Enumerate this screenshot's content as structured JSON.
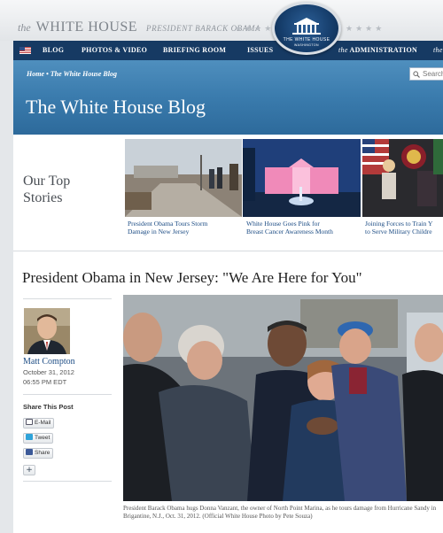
{
  "masthead": {
    "brand_the": "the",
    "brand_name": "WHITE HOUSE",
    "brand_sub": "PRESIDENT BARACK OBAMA",
    "seal_line1": "THE WHITE HOUSE",
    "seal_line2": "WASHINGTON"
  },
  "nav": {
    "items": [
      "BLOG",
      "PHOTOS & VIDEO",
      "BRIEFING ROOM",
      "ISSUES"
    ],
    "admin_the": "the",
    "admin_label": "ADMINISTRATION",
    "overflow": "the"
  },
  "banner": {
    "breadcrumb": "Home • The White House Blog",
    "search_placeholder": "Search",
    "title": "The White House Blog"
  },
  "top_stories": {
    "heading_line1": "Our Top",
    "heading_line2": "Stories",
    "items": [
      {
        "line1": "President Obama Tours Storm",
        "line2": "Damage in New Jersey"
      },
      {
        "line1": "White House Goes Pink for",
        "line2": "Breast Cancer Awareness Month"
      },
      {
        "line1": "Joining Forces to Train Y",
        "line2": "to Serve Military Childre"
      }
    ]
  },
  "post": {
    "title": "President Obama in New Jersey: \"We Are Here for You\"",
    "author": "Matt Compton",
    "date": "October 31, 2012",
    "time": "06:55 PM EDT",
    "share_label": "Share This Post",
    "share_buttons": [
      "E-Mail",
      "Tweet",
      "Share"
    ],
    "plus_label": "+",
    "photo_caption": "President Barack Obama hugs Donna Vanzant, the owner of North Point Marina, as he tours damage from Hurricane Sandy in Brigantine, N.J., Oct. 31, 2012. (Official White House Photo by Pete Souza)"
  },
  "colors": {
    "nav_bg": "#163a63",
    "banner_blue": "#3a7bad",
    "link_blue": "#1c4c84"
  }
}
